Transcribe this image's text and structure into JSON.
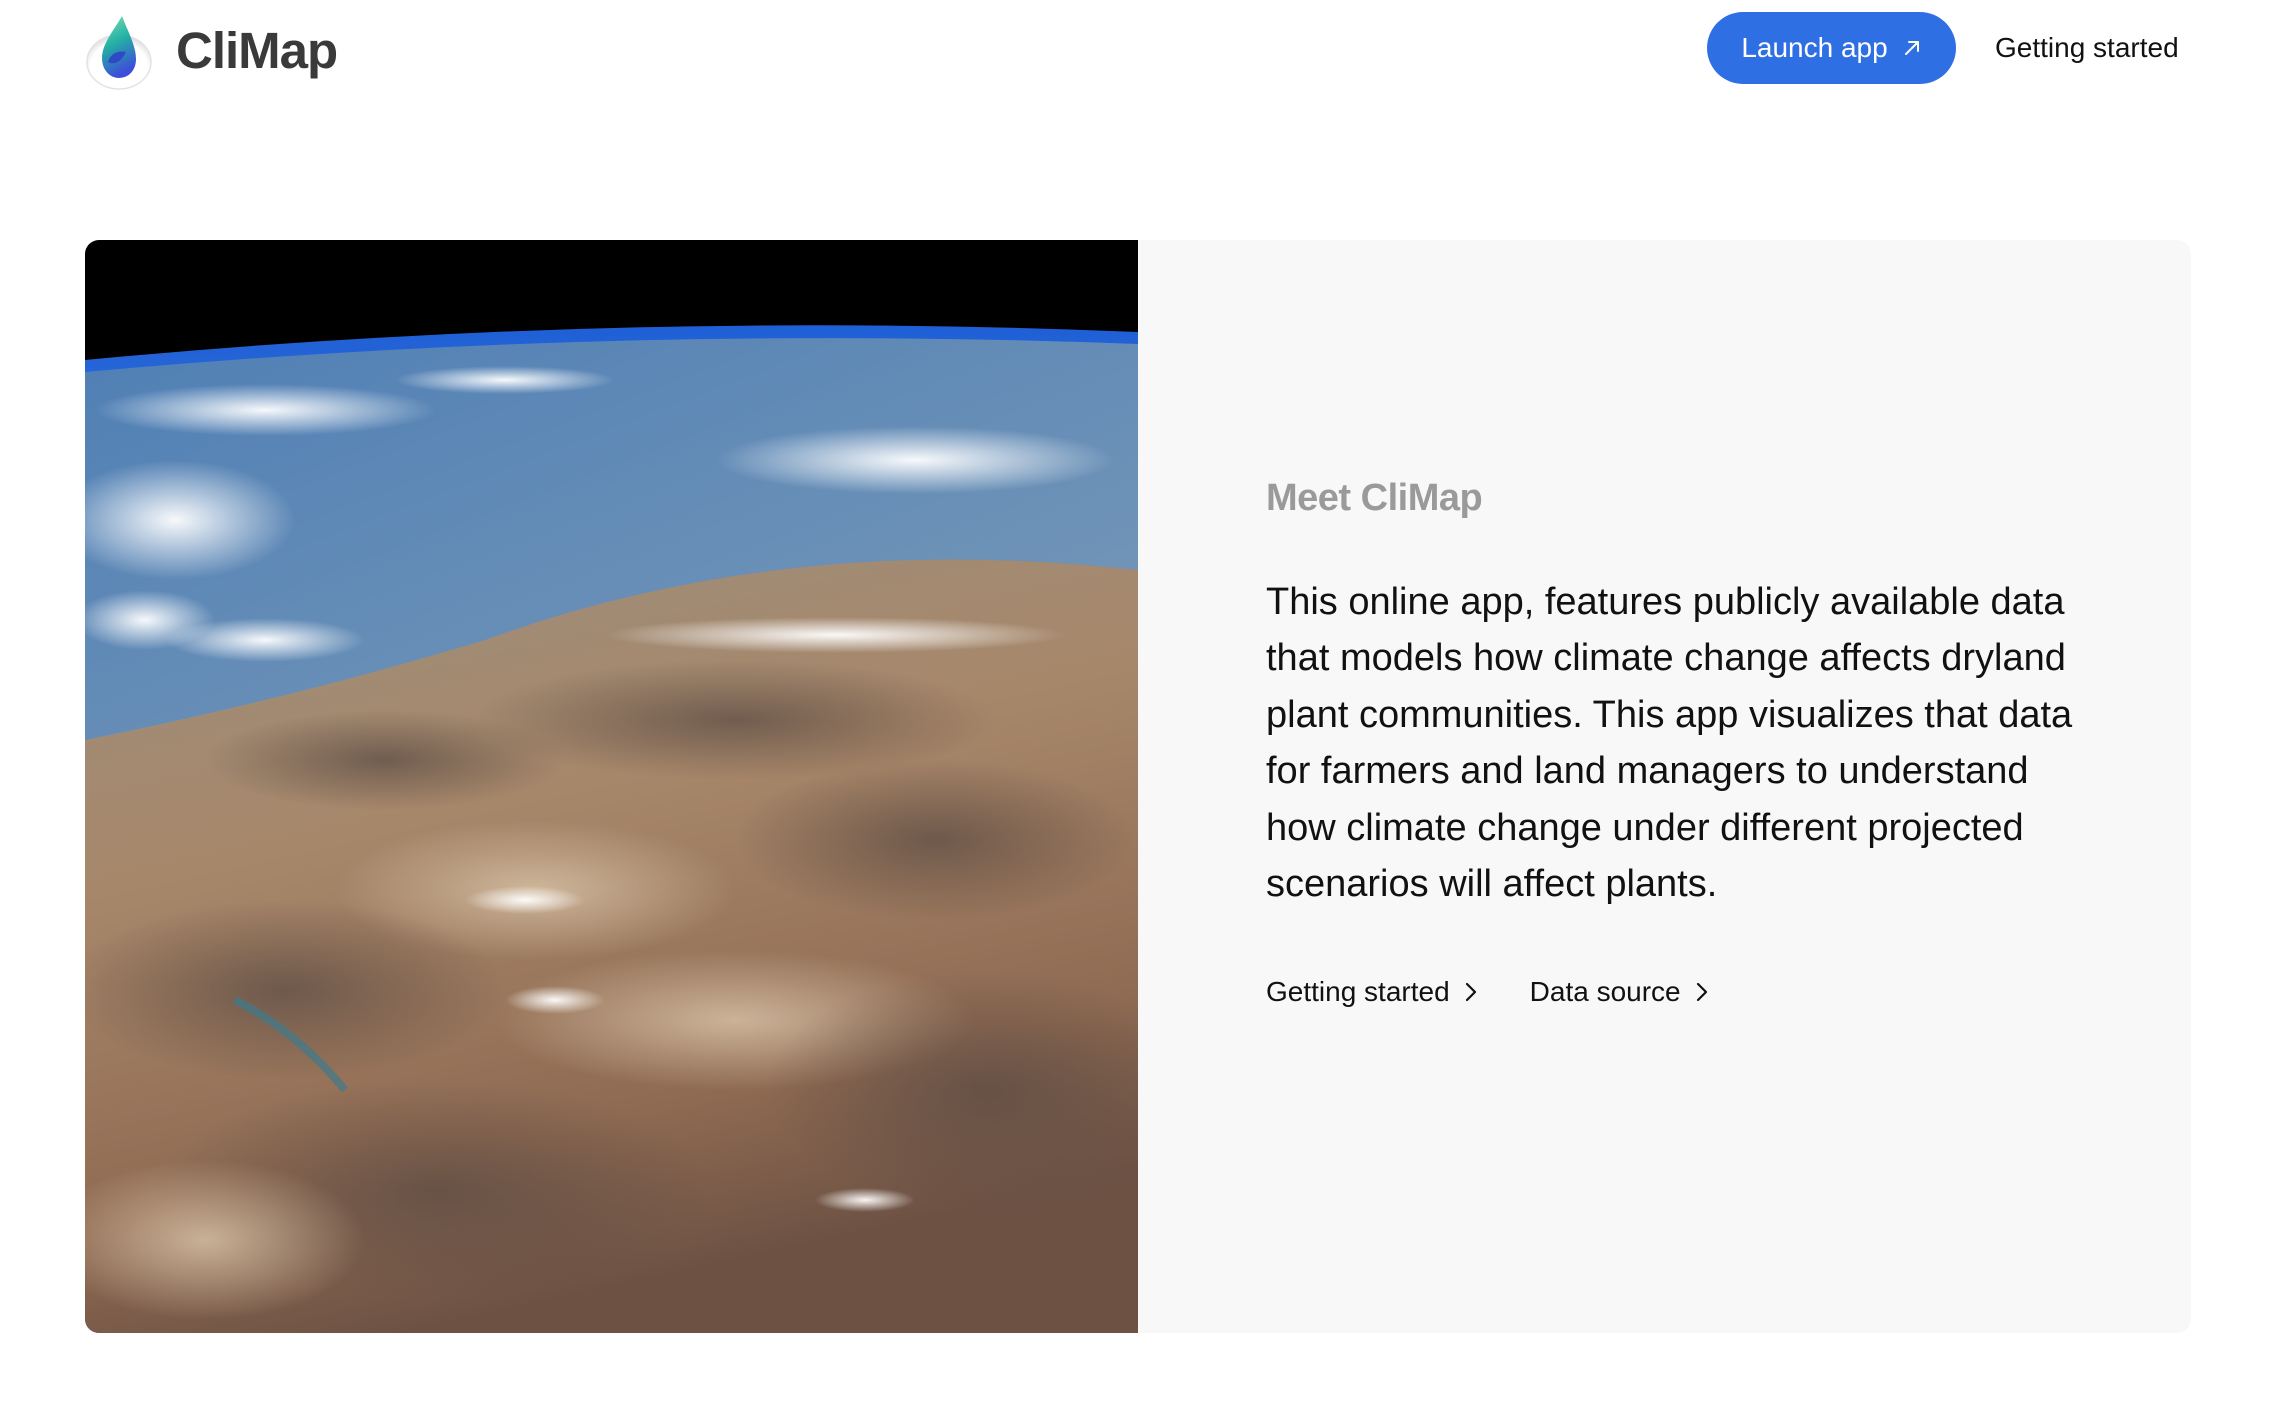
{
  "brand": {
    "name": "CliMap",
    "logo_icon": "water-drop-logo-icon"
  },
  "header": {
    "launch_label": "Launch app",
    "launch_icon": "external-arrow-icon",
    "nav_getting_started": "Getting started"
  },
  "hero": {
    "image": "earth-from-orbit-desert-photo",
    "eyebrow": "Meet CliMap",
    "description": "This online app, features publicly available data that models how climate change affects dryland plant communities. This app visualizes that data for farmers and land managers to understand how climate change under different projected scenarios will affect plants.",
    "links": [
      {
        "label": "Getting started",
        "icon": "chevron-right-icon"
      },
      {
        "label": "Data source",
        "icon": "chevron-right-icon"
      }
    ]
  },
  "colors": {
    "accent": "#2f6fe4",
    "panel_bg": "#f8f8f8",
    "muted_text": "#9a9a9a"
  }
}
